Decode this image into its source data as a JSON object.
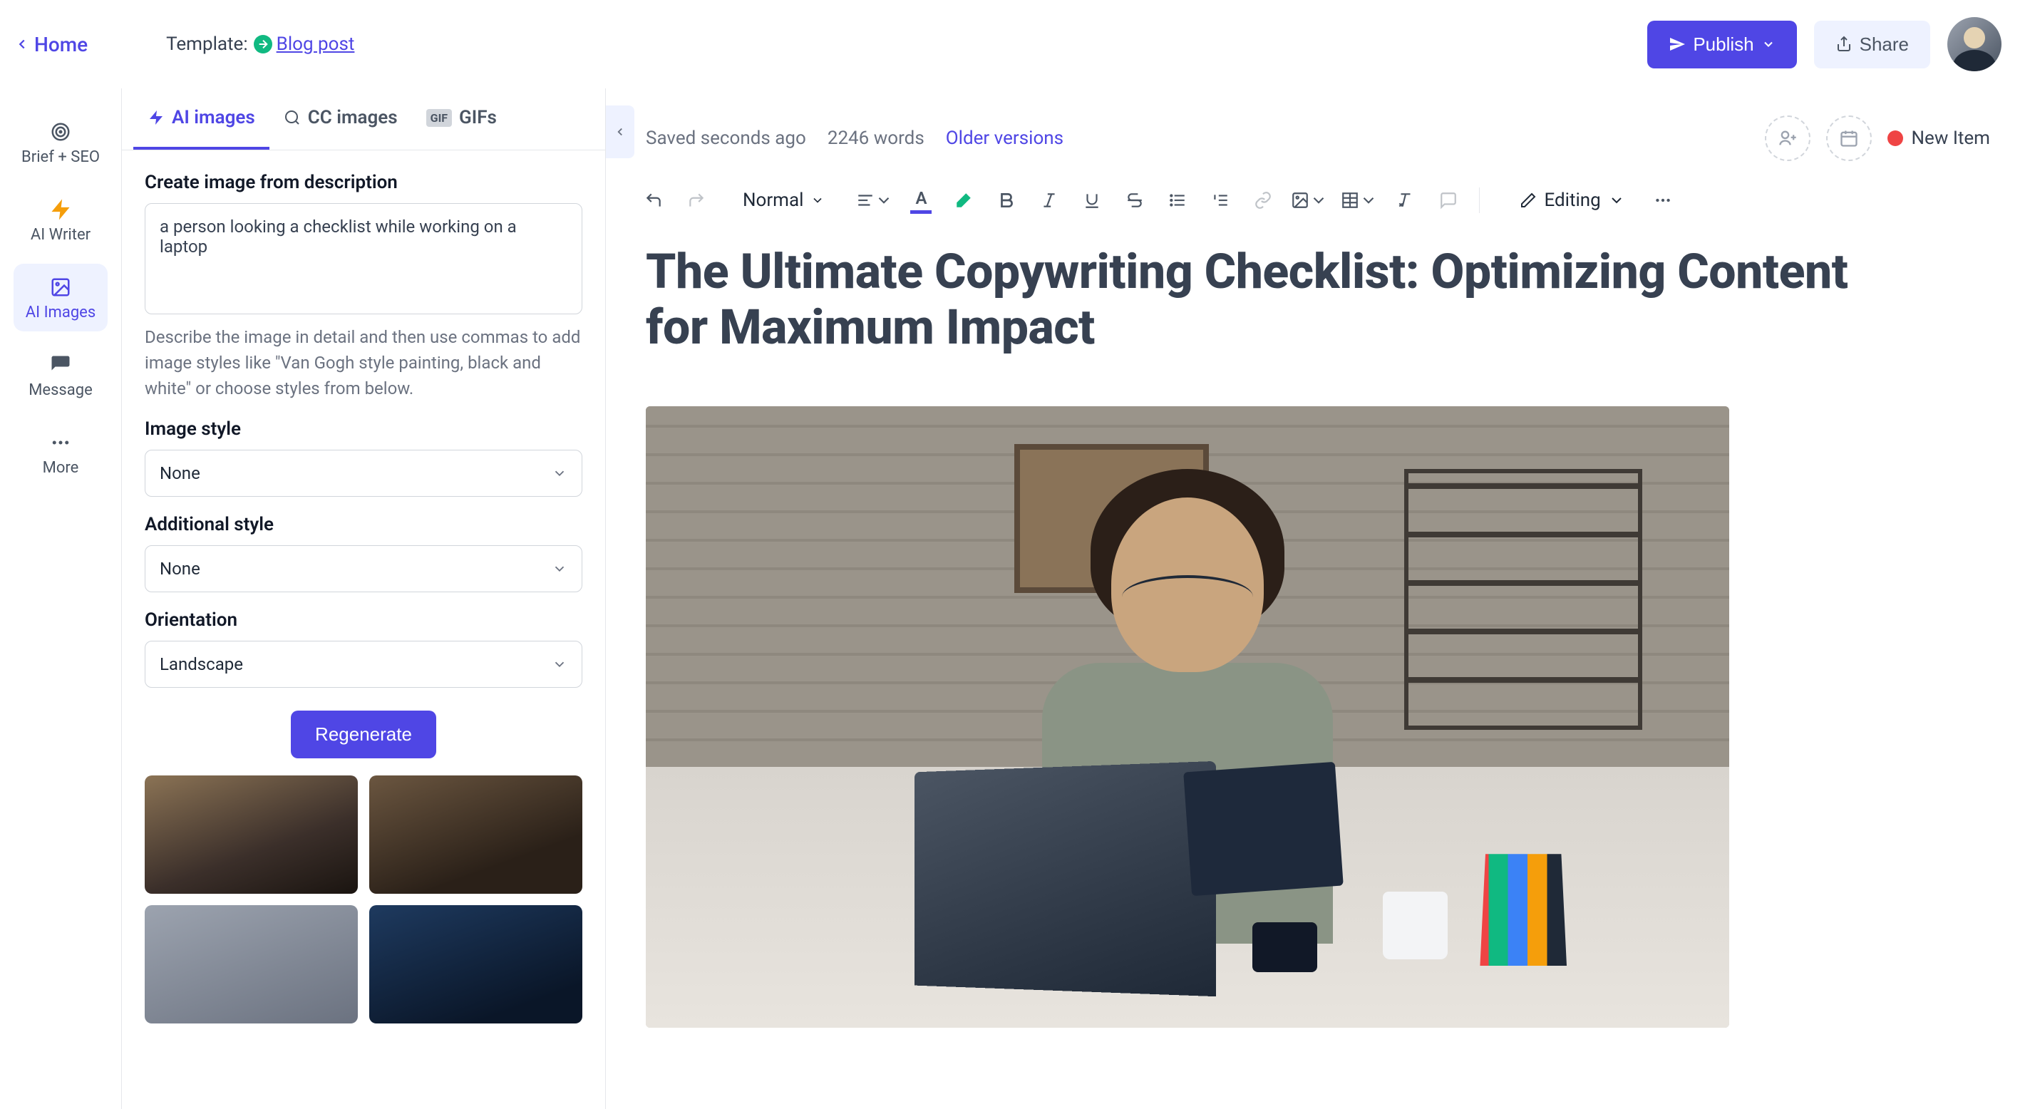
{
  "topbar": {
    "home": "Home",
    "template_label": "Template:",
    "template_link": "Blog post",
    "publish": "Publish",
    "share": "Share"
  },
  "vnav": {
    "brief": "Brief + SEO",
    "writer": "AI Writer",
    "images": "AI Images",
    "message": "Message",
    "more": "More"
  },
  "panel": {
    "tabs": {
      "ai_images": "AI images",
      "cc_images": "CC images",
      "gifs": "GIFs"
    },
    "create_label": "Create image from description",
    "prompt_value": "a person looking a checklist while working on a laptop",
    "help_text": "Describe the image in detail and then use commas to add image styles like \"Van Gogh style painting, black and white\" or choose styles from below.",
    "image_style_label": "Image style",
    "image_style_value": "None",
    "additional_style_label": "Additional style",
    "additional_style_value": "None",
    "orientation_label": "Orientation",
    "orientation_value": "Landscape",
    "regenerate": "Regenerate"
  },
  "editor": {
    "saved": "Saved seconds ago",
    "wordcount": "2246 words",
    "older_versions": "Older versions",
    "new_item": "New Item",
    "text_style": "Normal",
    "mode": "Editing"
  },
  "document": {
    "title": "The Ultimate Copywriting Checklist: Optimizing Content for Maximum Impact"
  }
}
